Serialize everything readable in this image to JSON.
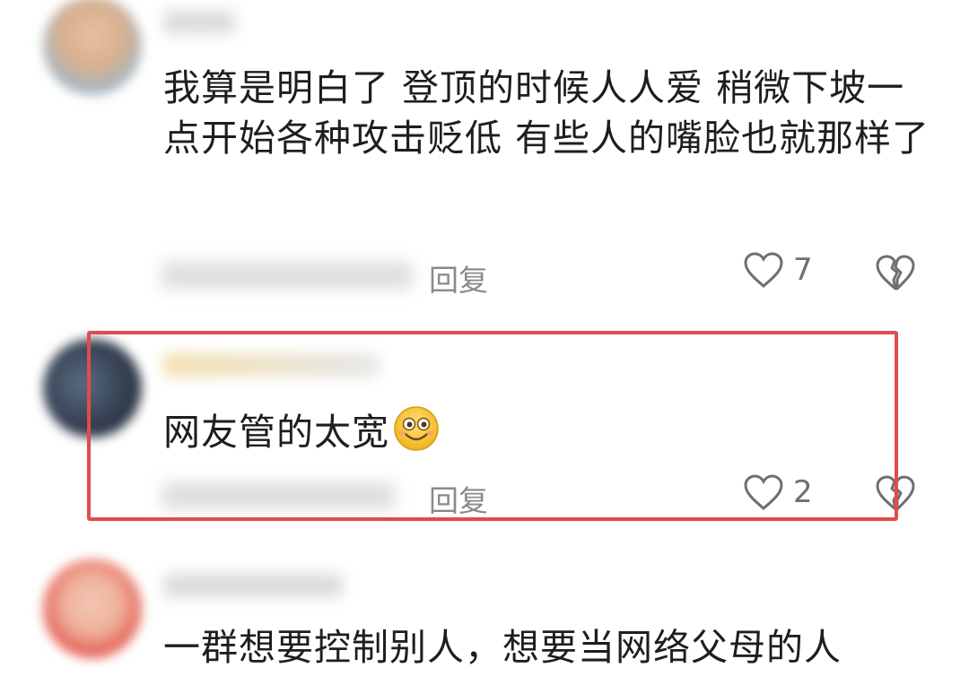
{
  "comments": [
    {
      "text": "我算是明白了 登顶的时候人人爱 稍微下坡一点开始各种攻击贬低 有些人的嘴脸也就那样了",
      "reply_label": "回复",
      "like_count": "7"
    },
    {
      "text": "网友管的太宽",
      "emoji": "smiling-face-emoji",
      "reply_label": "回复",
      "like_count": "2"
    },
    {
      "text": "一群想要控制别人，想要当网络父母的人"
    }
  ],
  "colors": {
    "highlight_border": "#e24b4b",
    "text": "#1e1e1e",
    "muted": "#8a8a8a"
  }
}
